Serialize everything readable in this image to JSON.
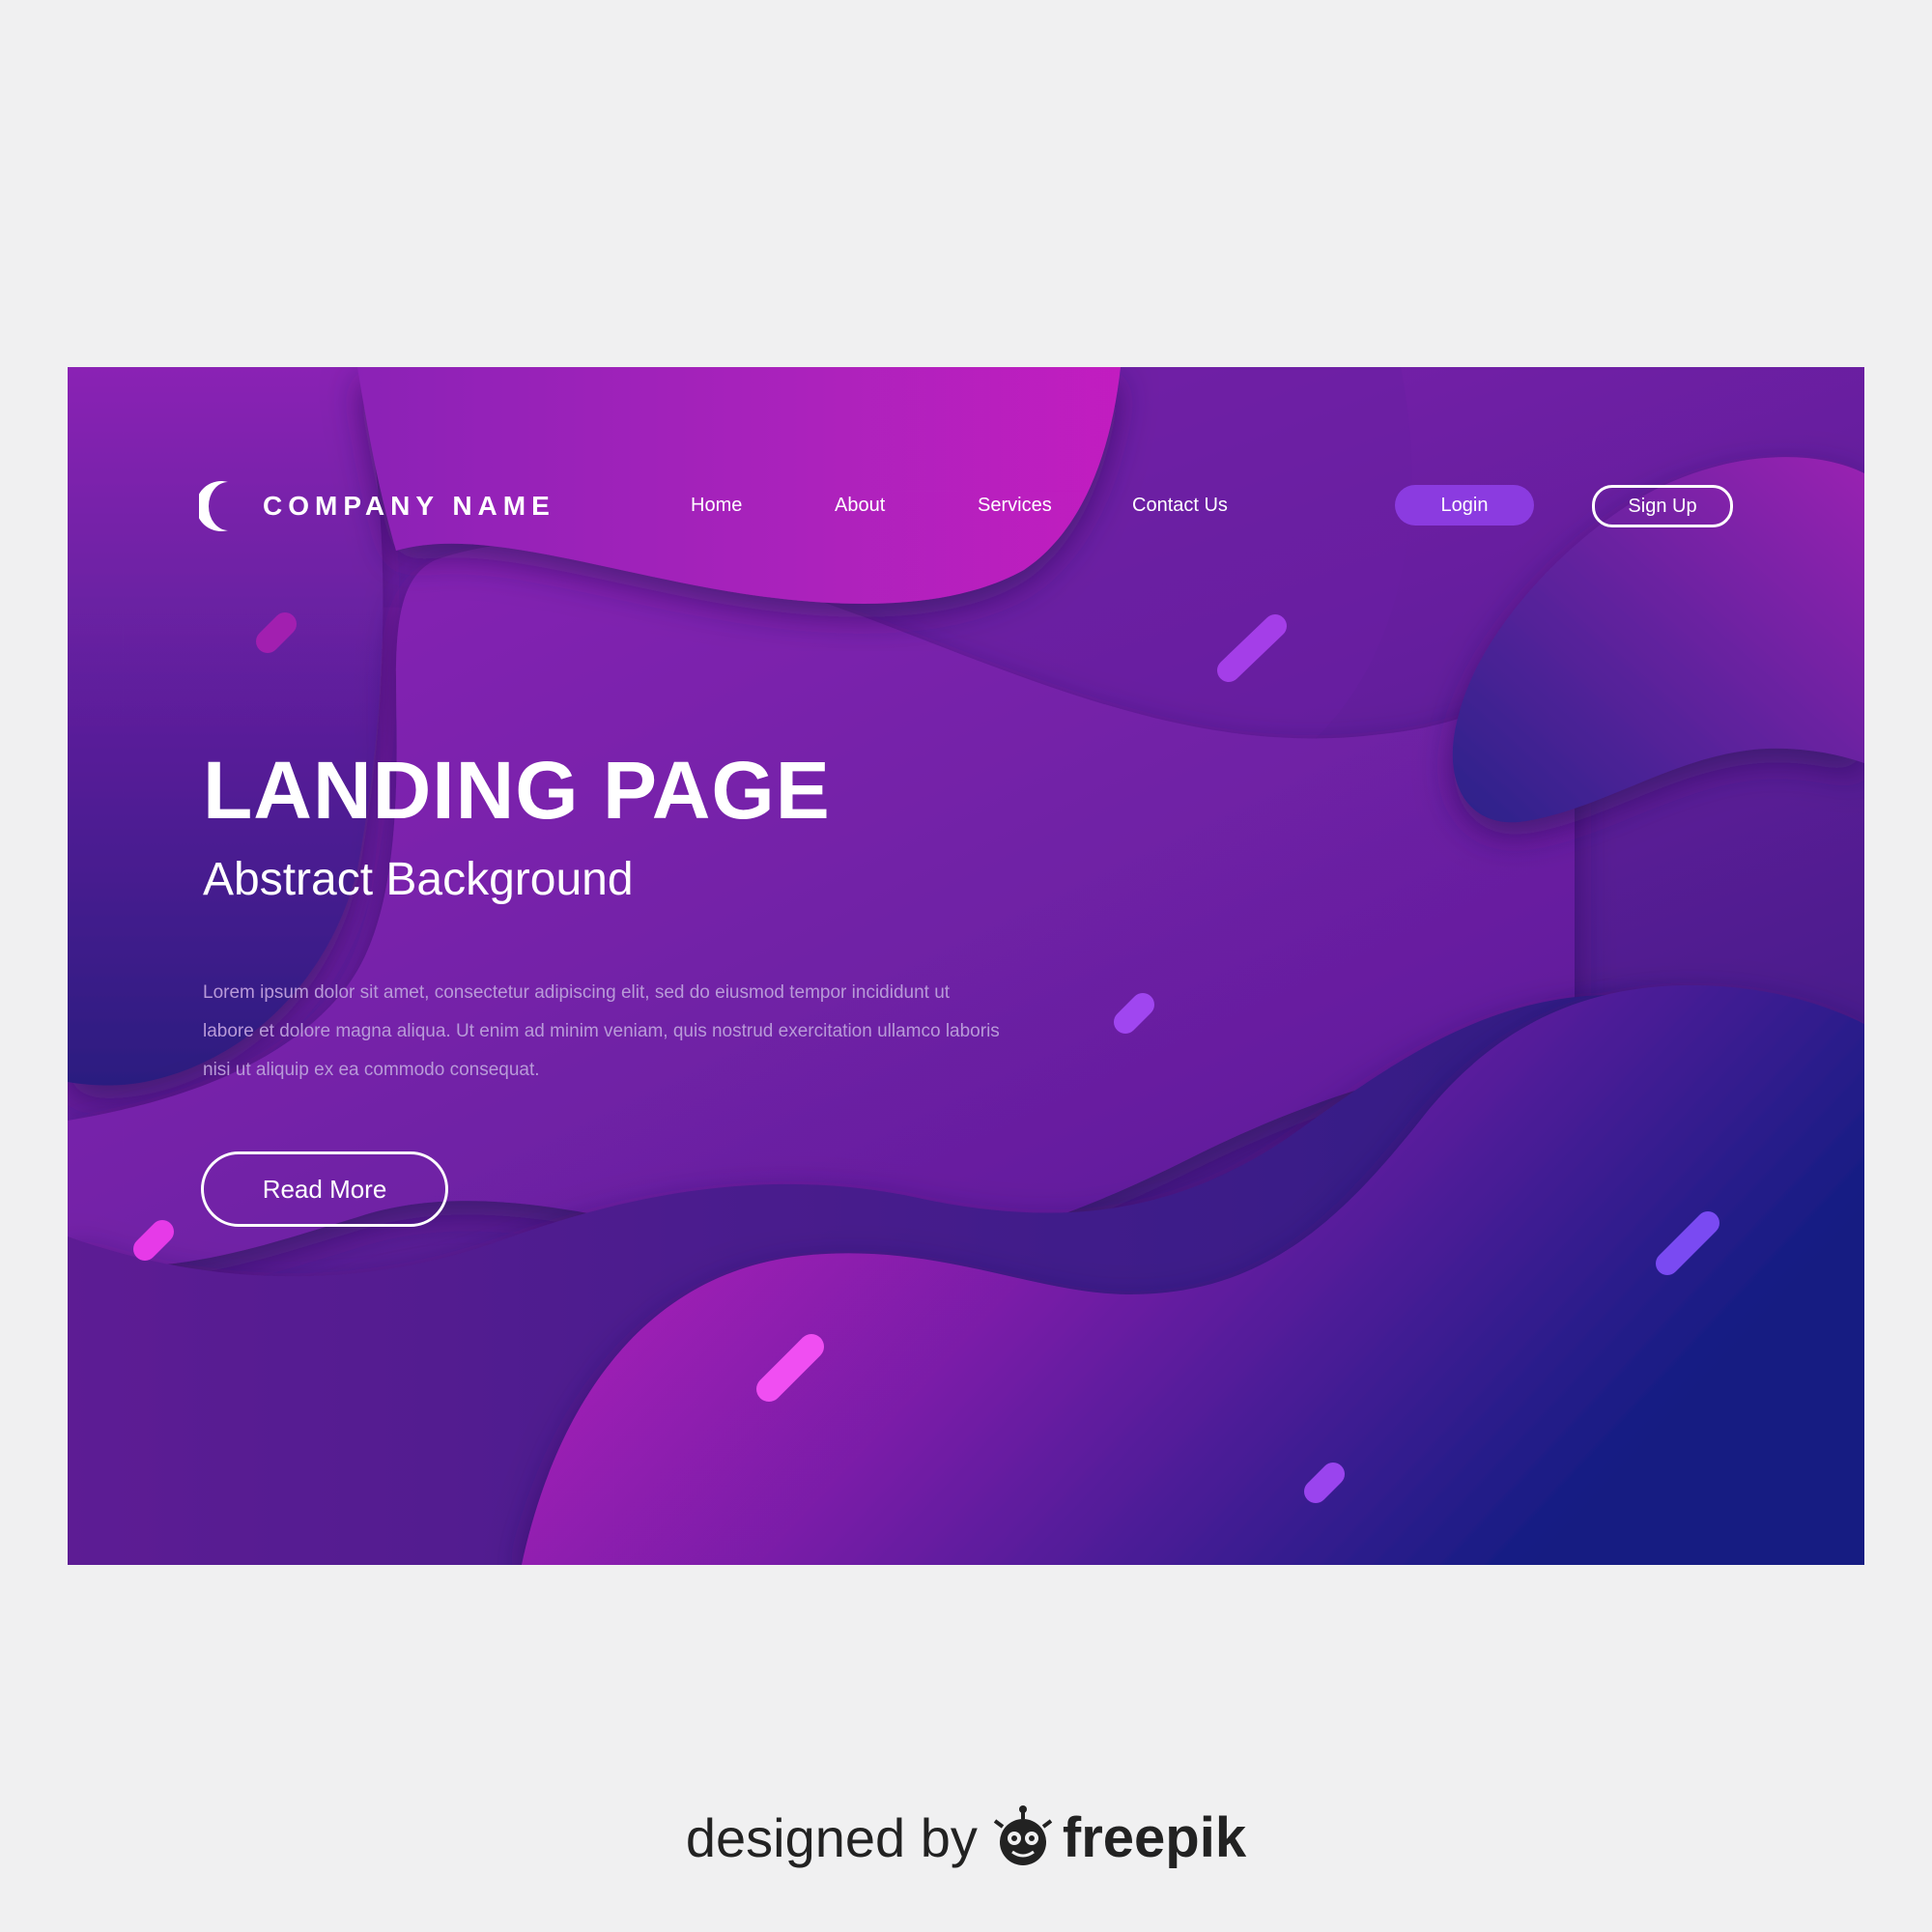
{
  "brand": {
    "name": "COMPANY NAME",
    "logo_icon": "crescent-icon"
  },
  "nav": {
    "items": [
      {
        "label": "Home"
      },
      {
        "label": "About"
      },
      {
        "label": "Services"
      },
      {
        "label": "Contact Us"
      }
    ],
    "login_label": "Login",
    "signup_label": "Sign Up"
  },
  "hero": {
    "title": "LANDING PAGE",
    "subtitle": "Abstract Background",
    "body": "Lorem ipsum dolor sit amet, consectetur adipiscing elit, sed do eiusmod tempor incididunt ut labore et dolore magna aliqua. Ut enim ad minim veniam, quis nostrud exercitation ullamco laboris nisi ut aliquip ex ea commodo consequat.",
    "cta_label": "Read More"
  },
  "credit": {
    "prefix": "designed by",
    "brand": "freepik",
    "logo_icon": "freepik-mascot-icon"
  },
  "colors": {
    "page_background": "#f0f0f1",
    "hero_magenta": "#c21fc0",
    "hero_purple": "#6e1fa4",
    "hero_navy": "#1b1b7a",
    "login_button": "#8b3be0",
    "body_text": "#b89ad8"
  }
}
